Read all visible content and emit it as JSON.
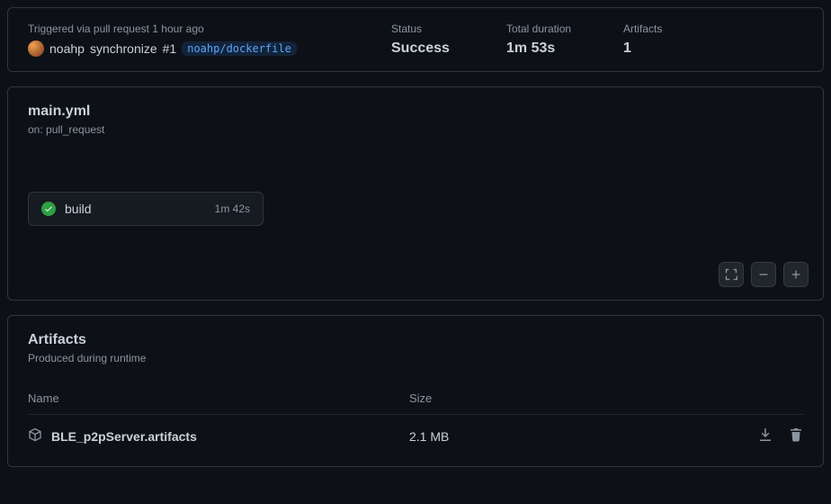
{
  "summary": {
    "trigger_label": "Triggered via pull request 1 hour ago",
    "author": "noahp",
    "action": "synchronize",
    "pr_number": "#1",
    "branch": "noahp/dockerfile",
    "status_label": "Status",
    "status_value": "Success",
    "duration_label": "Total duration",
    "duration_value": "1m 53s",
    "artifacts_label": "Artifacts",
    "artifacts_value": "1"
  },
  "workflow": {
    "name": "main.yml",
    "trigger": "on: pull_request",
    "job": {
      "name": "build",
      "duration": "1m 42s"
    }
  },
  "artifacts": {
    "title": "Artifacts",
    "subtitle": "Produced during runtime",
    "columns": {
      "name": "Name",
      "size": "Size"
    },
    "items": [
      {
        "name": "BLE_p2pServer.artifacts",
        "size": "2.1 MB"
      }
    ]
  }
}
